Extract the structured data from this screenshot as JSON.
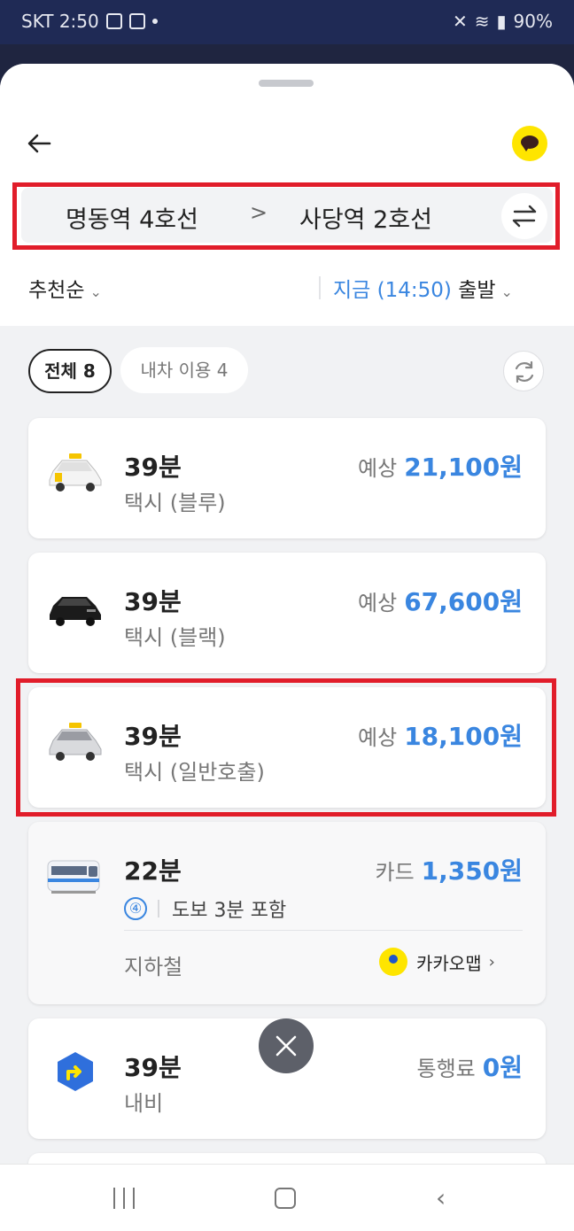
{
  "status_bar": {
    "carrier_time": "SKT 2:50",
    "battery": "90%"
  },
  "route": {
    "origin": "명동역 4호선",
    "arrow": ">",
    "destination": "사당역 2호선"
  },
  "sort": {
    "label": "추천순"
  },
  "departure": {
    "label_prefix": "지금",
    "time": "(14:50)",
    "label_suffix": "출발"
  },
  "filters": [
    {
      "label": "전체 8",
      "selected": true
    },
    {
      "label": "내차 이용 4",
      "selected": false
    }
  ],
  "options": [
    {
      "icon": "taxi-blue-icon",
      "duration": "39분",
      "type": "택시 (블루)",
      "price_label": "예상",
      "price": "21,100원"
    },
    {
      "icon": "taxi-black-icon",
      "duration": "39분",
      "type": "택시 (블랙)",
      "price_label": "예상",
      "price": "67,600원"
    },
    {
      "icon": "taxi-general-icon",
      "duration": "39분",
      "type": "택시 (일반호출)",
      "price_label": "예상",
      "price": "18,100원"
    },
    {
      "icon": "subway-icon",
      "duration": "22분",
      "line_badge": "④",
      "walk": "도보 3분 포함",
      "mode": "지하철",
      "app_link": "카카오맵",
      "price_label": "카드",
      "price": "1,350원"
    },
    {
      "icon": "navi-icon",
      "duration": "39분",
      "type": "내비",
      "price_label": "통행료",
      "price": "0원"
    }
  ],
  "colors": {
    "accent_blue": "#3a86e0",
    "highlight_red": "#e11d2a",
    "kakao_yellow": "#fee500"
  }
}
